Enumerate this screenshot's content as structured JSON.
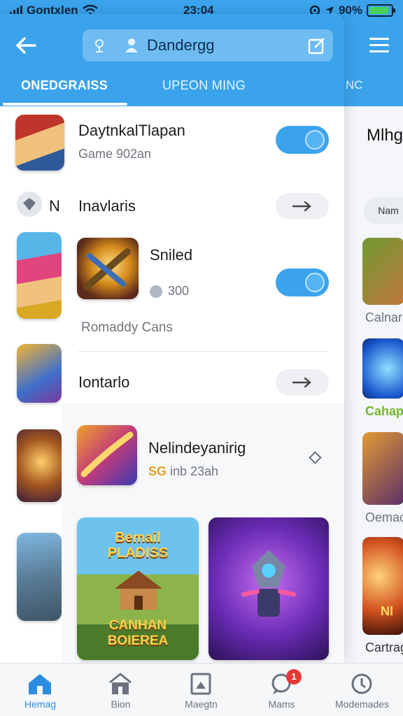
{
  "status_bar": {
    "carrier": "Gontxlen",
    "time": "23:04",
    "battery_percent": "90%",
    "battery_level": 0.9,
    "icons": [
      "signal-icon",
      "wifi-icon",
      "lock-rotation-icon",
      "location-arrow-icon",
      "battery-icon"
    ]
  },
  "header": {
    "search_value": "Dandergg",
    "tabs": [
      {
        "label": "ONEDGRAISS",
        "active": true
      },
      {
        "label": "UPEON MING",
        "active": false
      },
      {
        "label": "NC",
        "active": false
      }
    ],
    "accent_color": "#3aa3ec"
  },
  "list": {
    "item1": {
      "title": "DaytnkalTlapan",
      "subtitle": "Game 902an",
      "toggle_on": true
    },
    "section1": {
      "label": "Inavlaris",
      "prefix": "N"
    },
    "item2": {
      "title": "Sniled",
      "rating": "300",
      "subtitle": "Romaddy Cans",
      "toggle_on": true
    },
    "section2": {
      "label": "Iontarlo"
    },
    "featured": {
      "title": "Nelindeyanirig",
      "subtitle": "inb 23ah",
      "badge": "SG"
    }
  },
  "cards": {
    "card1": {
      "top_text": "Bemail\nPLADISS",
      "bottom_text": "CANHAN\nBOIEREA"
    }
  },
  "background_page": {
    "title": "Mlhg",
    "button_label": "Nam",
    "labels": [
      "Calnar",
      "Cahap",
      "Oemac",
      "Cartrag"
    ],
    "banner_text": "NI"
  },
  "bottom_nav": [
    {
      "label": "Hemag",
      "icon": "home-icon",
      "active": true
    },
    {
      "label": "Bion",
      "icon": "store-icon",
      "active": false
    },
    {
      "label": "Maegtn",
      "icon": "picture-frame-icon",
      "active": false
    },
    {
      "label": "Mams",
      "icon": "chat-icon",
      "active": false,
      "badge": "1"
    },
    {
      "label": "Modemades",
      "icon": "clock-icon",
      "active": false
    }
  ]
}
